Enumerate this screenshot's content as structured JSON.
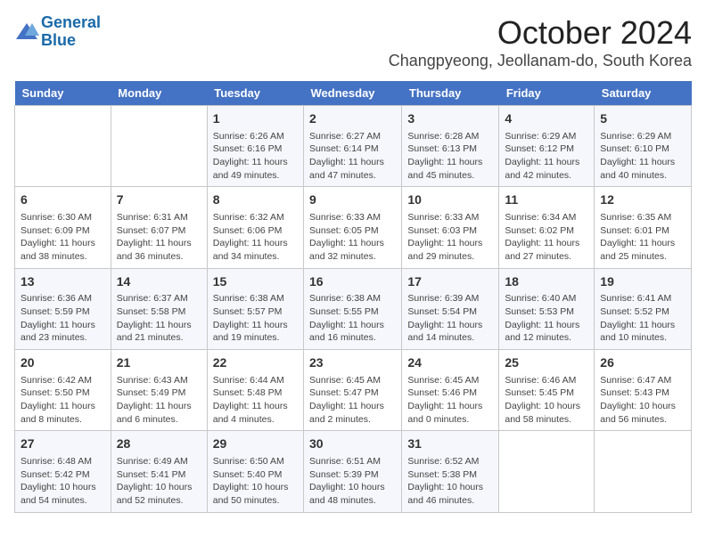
{
  "logo": {
    "line1": "General",
    "line2": "Blue"
  },
  "title": "October 2024",
  "subtitle": "Changpyeong, Jeollanam-do, South Korea",
  "days_of_week": [
    "Sunday",
    "Monday",
    "Tuesday",
    "Wednesday",
    "Thursday",
    "Friday",
    "Saturday"
  ],
  "weeks": [
    [
      {
        "day": "",
        "info": ""
      },
      {
        "day": "",
        "info": ""
      },
      {
        "day": "1",
        "info": "Sunrise: 6:26 AM\nSunset: 6:16 PM\nDaylight: 11 hours and 49 minutes."
      },
      {
        "day": "2",
        "info": "Sunrise: 6:27 AM\nSunset: 6:14 PM\nDaylight: 11 hours and 47 minutes."
      },
      {
        "day": "3",
        "info": "Sunrise: 6:28 AM\nSunset: 6:13 PM\nDaylight: 11 hours and 45 minutes."
      },
      {
        "day": "4",
        "info": "Sunrise: 6:29 AM\nSunset: 6:12 PM\nDaylight: 11 hours and 42 minutes."
      },
      {
        "day": "5",
        "info": "Sunrise: 6:29 AM\nSunset: 6:10 PM\nDaylight: 11 hours and 40 minutes."
      }
    ],
    [
      {
        "day": "6",
        "info": "Sunrise: 6:30 AM\nSunset: 6:09 PM\nDaylight: 11 hours and 38 minutes."
      },
      {
        "day": "7",
        "info": "Sunrise: 6:31 AM\nSunset: 6:07 PM\nDaylight: 11 hours and 36 minutes."
      },
      {
        "day": "8",
        "info": "Sunrise: 6:32 AM\nSunset: 6:06 PM\nDaylight: 11 hours and 34 minutes."
      },
      {
        "day": "9",
        "info": "Sunrise: 6:33 AM\nSunset: 6:05 PM\nDaylight: 11 hours and 32 minutes."
      },
      {
        "day": "10",
        "info": "Sunrise: 6:33 AM\nSunset: 6:03 PM\nDaylight: 11 hours and 29 minutes."
      },
      {
        "day": "11",
        "info": "Sunrise: 6:34 AM\nSunset: 6:02 PM\nDaylight: 11 hours and 27 minutes."
      },
      {
        "day": "12",
        "info": "Sunrise: 6:35 AM\nSunset: 6:01 PM\nDaylight: 11 hours and 25 minutes."
      }
    ],
    [
      {
        "day": "13",
        "info": "Sunrise: 6:36 AM\nSunset: 5:59 PM\nDaylight: 11 hours and 23 minutes."
      },
      {
        "day": "14",
        "info": "Sunrise: 6:37 AM\nSunset: 5:58 PM\nDaylight: 11 hours and 21 minutes."
      },
      {
        "day": "15",
        "info": "Sunrise: 6:38 AM\nSunset: 5:57 PM\nDaylight: 11 hours and 19 minutes."
      },
      {
        "day": "16",
        "info": "Sunrise: 6:38 AM\nSunset: 5:55 PM\nDaylight: 11 hours and 16 minutes."
      },
      {
        "day": "17",
        "info": "Sunrise: 6:39 AM\nSunset: 5:54 PM\nDaylight: 11 hours and 14 minutes."
      },
      {
        "day": "18",
        "info": "Sunrise: 6:40 AM\nSunset: 5:53 PM\nDaylight: 11 hours and 12 minutes."
      },
      {
        "day": "19",
        "info": "Sunrise: 6:41 AM\nSunset: 5:52 PM\nDaylight: 11 hours and 10 minutes."
      }
    ],
    [
      {
        "day": "20",
        "info": "Sunrise: 6:42 AM\nSunset: 5:50 PM\nDaylight: 11 hours and 8 minutes."
      },
      {
        "day": "21",
        "info": "Sunrise: 6:43 AM\nSunset: 5:49 PM\nDaylight: 11 hours and 6 minutes."
      },
      {
        "day": "22",
        "info": "Sunrise: 6:44 AM\nSunset: 5:48 PM\nDaylight: 11 hours and 4 minutes."
      },
      {
        "day": "23",
        "info": "Sunrise: 6:45 AM\nSunset: 5:47 PM\nDaylight: 11 hours and 2 minutes."
      },
      {
        "day": "24",
        "info": "Sunrise: 6:45 AM\nSunset: 5:46 PM\nDaylight: 11 hours and 0 minutes."
      },
      {
        "day": "25",
        "info": "Sunrise: 6:46 AM\nSunset: 5:45 PM\nDaylight: 10 hours and 58 minutes."
      },
      {
        "day": "26",
        "info": "Sunrise: 6:47 AM\nSunset: 5:43 PM\nDaylight: 10 hours and 56 minutes."
      }
    ],
    [
      {
        "day": "27",
        "info": "Sunrise: 6:48 AM\nSunset: 5:42 PM\nDaylight: 10 hours and 54 minutes."
      },
      {
        "day": "28",
        "info": "Sunrise: 6:49 AM\nSunset: 5:41 PM\nDaylight: 10 hours and 52 minutes."
      },
      {
        "day": "29",
        "info": "Sunrise: 6:50 AM\nSunset: 5:40 PM\nDaylight: 10 hours and 50 minutes."
      },
      {
        "day": "30",
        "info": "Sunrise: 6:51 AM\nSunset: 5:39 PM\nDaylight: 10 hours and 48 minutes."
      },
      {
        "day": "31",
        "info": "Sunrise: 6:52 AM\nSunset: 5:38 PM\nDaylight: 10 hours and 46 minutes."
      },
      {
        "day": "",
        "info": ""
      },
      {
        "day": "",
        "info": ""
      }
    ]
  ]
}
